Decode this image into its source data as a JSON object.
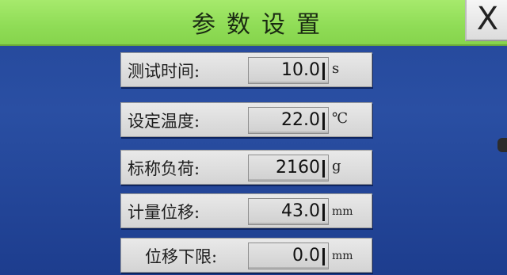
{
  "window": {
    "title": "参数设置",
    "close_label": "X"
  },
  "params": [
    {
      "label": "测试时间:",
      "value": "10.0",
      "unit": "s"
    },
    {
      "label": "设定温度:",
      "value": "22.0",
      "unit": "℃"
    },
    {
      "label": "标称负荷:",
      "value": "2160",
      "unit": "g"
    },
    {
      "label": "计量位移:",
      "value": "43.0",
      "unit": "mm"
    },
    {
      "label": "位移下限:",
      "value": "0.0",
      "unit": "mm"
    }
  ]
}
